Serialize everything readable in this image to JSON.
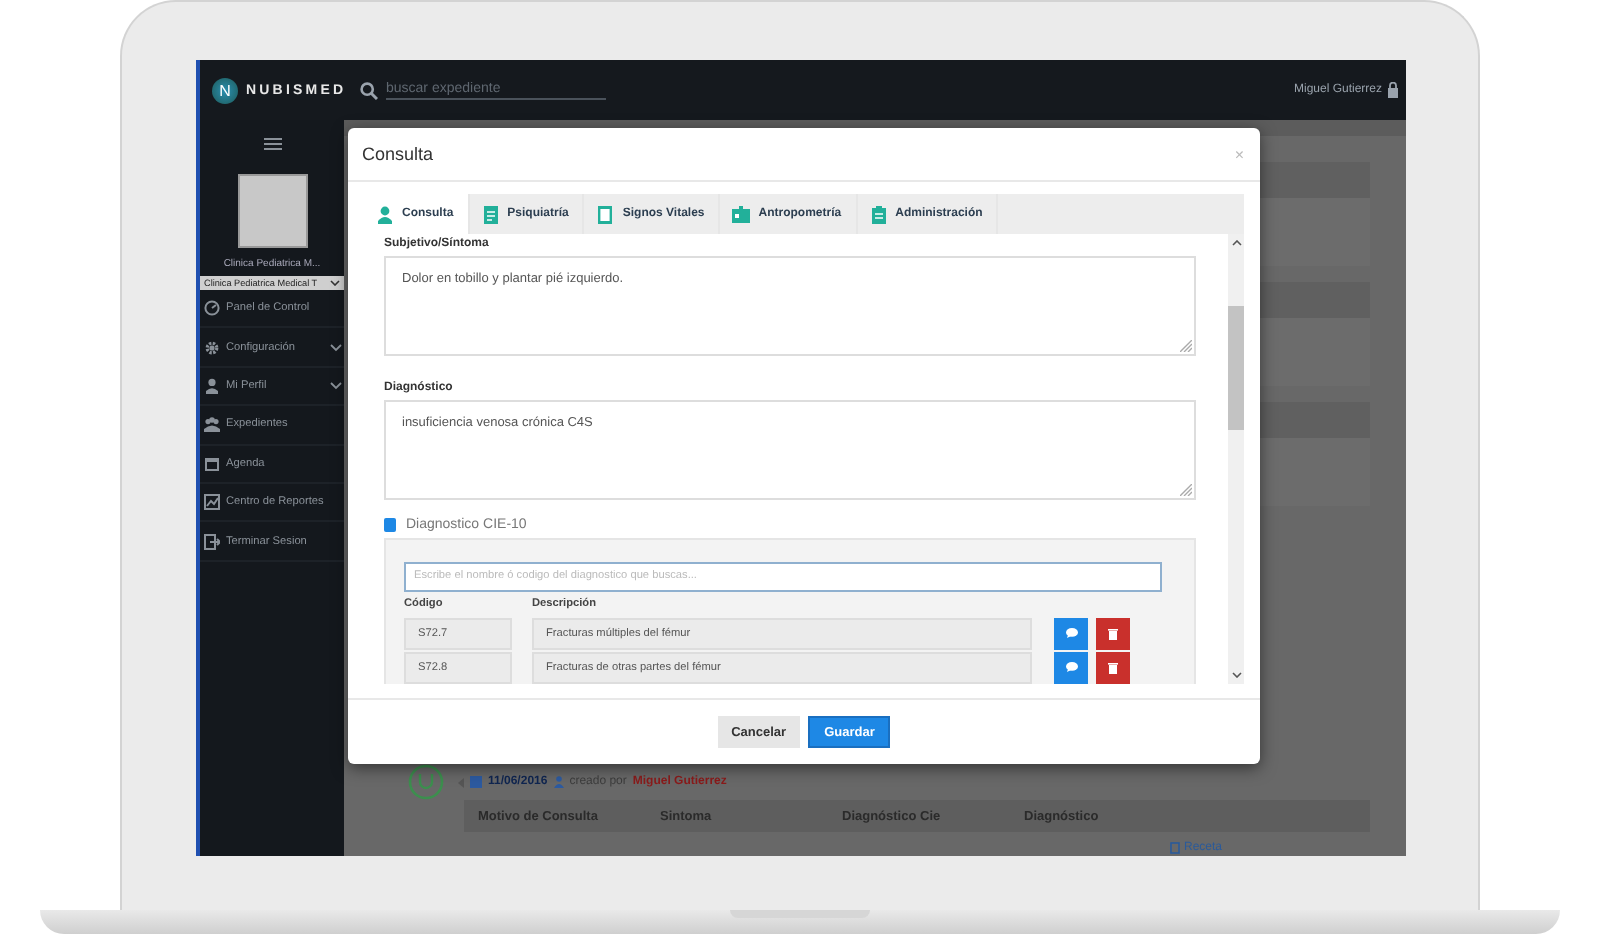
{
  "app": {
    "logo_letter": "N",
    "brand": "NUBISMED",
    "search_placeholder": "buscar expediente",
    "user": "Miguel Gutierrez"
  },
  "sidebar": {
    "clinic_name": "Clinica Pediatrica M...",
    "clinic_select": "Clinica Pediatrica Medical T",
    "items": [
      {
        "label": "Panel de Control",
        "expandable": false
      },
      {
        "label": "Configuración",
        "expandable": true
      },
      {
        "label": "Mi Perfil",
        "expandable": true
      },
      {
        "label": "Expedientes",
        "expandable": false
      },
      {
        "label": "Agenda",
        "expandable": false
      },
      {
        "label": "Centro de Reportes",
        "expandable": false
      },
      {
        "label": "Terminar Sesion",
        "expandable": false
      }
    ]
  },
  "background": {
    "entry_date": "11/06/2016",
    "created_by_label": "creado por",
    "author": "Miguel Gutierrez",
    "columns": [
      "Motivo de Consulta",
      "Sintoma",
      "Diagnóstico Cie",
      "Diagnóstico"
    ],
    "link": "Receta"
  },
  "modal": {
    "title": "Consulta",
    "close": "×",
    "tabs": [
      {
        "label": "Consulta",
        "selected": true
      },
      {
        "label": "Psiquiatría",
        "selected": false
      },
      {
        "label": "Signos Vitales",
        "selected": false
      },
      {
        "label": "Antropometría",
        "selected": false
      },
      {
        "label": "Administración",
        "selected": false
      }
    ],
    "fields": [
      {
        "label": "Subjetivo/Síntoma",
        "value": "Dolor en tobillo y plantar pié izquierdo."
      },
      {
        "label": "Diagnóstico",
        "value": "insuficiencia venosa crónica C4S"
      }
    ],
    "cie": {
      "title": "Diagnostico CIE-10",
      "search_placeholder": "Escribe el nombre ó codigo del diagnostico que buscas...",
      "columns": [
        "Código",
        "Descripción"
      ],
      "rows": [
        {
          "code": "S72.7",
          "description": "Fracturas múltiples del fémur"
        },
        {
          "code": "S72.8",
          "description": "Fracturas de otras partes del fémur"
        }
      ]
    },
    "buttons": [
      {
        "label": "Cancelar",
        "kind": "secondary"
      },
      {
        "label": "Guardar",
        "kind": "primary"
      }
    ]
  }
}
